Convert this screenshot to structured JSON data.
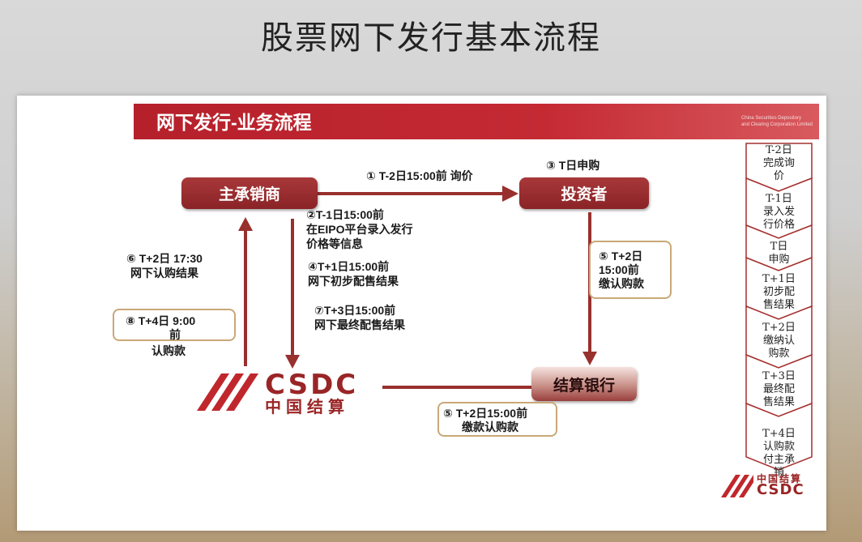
{
  "slide_title": "股票网下发行基本流程",
  "banner": {
    "title": "网下发行-业务流程",
    "org_line1": "China Securities Depository",
    "org_line2": "and Clearing Corporation Limited"
  },
  "nodes": {
    "underwriter": "主承销商",
    "investor": "投资者",
    "bank": "结算银行"
  },
  "logo": {
    "en": "CSDC",
    "cn": "中国结算"
  },
  "labels": {
    "step1": "① T-2日15:00前 询价",
    "step3": "③ T日申购",
    "step2_l1": "②T-1日15:00前",
    "step2_l2": "在EIPO平台录入发行",
    "step2_l3": "价格等信息",
    "step4_l1": "④T+1日15:00前",
    "step4_l2": "网下初步配售结果",
    "step7_l1": "⑦T+3日15:00前",
    "step7_l2": "网下最终配售结果",
    "step6_l1": "⑥ T+2日 17:30",
    "step6_l2": "网下认购结果"
  },
  "boxes": {
    "step8_l1": "⑧ T+4日 9:00",
    "step8_l2": "前",
    "step8_l3": "认购款",
    "step5a_l1": "⑤ T+2日",
    "step5a_l2": "15:00前",
    "step5a_l3": "缴认购款",
    "step5b_l1": "⑤ T+2日15:00前",
    "step5b_l2": "缴款认购款"
  },
  "timeline": [
    {
      "day": "T-2日",
      "l2": "完成询",
      "l3": "价"
    },
    {
      "day": "T-1日",
      "l2": "录入发",
      "l3": "行价格"
    },
    {
      "day": "T日",
      "l2": "申购",
      "l3": ""
    },
    {
      "day": "T+1日",
      "l2": "初步配",
      "l3": "售结果"
    },
    {
      "day": "T+2日",
      "l2": "缴纳认",
      "l3": "购款"
    },
    {
      "day": "T+3日",
      "l2": "最终配",
      "l3": "售结果"
    },
    {
      "day": "T+4日",
      "l2": "认购款",
      "l3": "付主承",
      "l4": "销"
    }
  ],
  "colors": {
    "brand_red": "#b5202b",
    "arrow": "#98302e",
    "box_border": "#c9a878"
  }
}
